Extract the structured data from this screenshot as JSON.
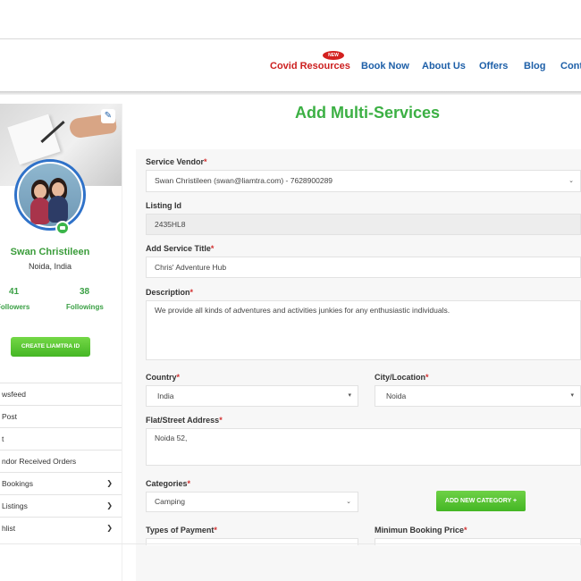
{
  "nav": {
    "badge": "NEW",
    "items": [
      "Covid Resources",
      "Book Now",
      "About Us",
      "Offers",
      "Blog",
      "Cont"
    ]
  },
  "profile": {
    "name": "Swan Christileen",
    "location": "Noida, India",
    "followers_count": "41",
    "followers_label": "Followers",
    "followings_count": "38",
    "followings_label": "Followings",
    "create_button": "CREATE LIAMTRA ID"
  },
  "menu": {
    "items": [
      "wsfeed",
      "Post",
      "t",
      "ndor Received Orders",
      "Bookings",
      "Listings",
      "hlist"
    ]
  },
  "form": {
    "title": "Add Multi-Services",
    "service_vendor_label": "Service Vendor",
    "service_vendor_value": "Swan Christileen (swan@liamtra.com) - 7628900289",
    "listing_id_label": "Listing Id",
    "listing_id_value": "2435HL8",
    "service_title_label": "Add Service Title",
    "service_title_value": "Chris' Adventure Hub",
    "description_label": "Description",
    "description_value": "We provide all kinds of adventures and activities junkies for any enthusiastic individuals.",
    "country_label": "Country",
    "country_value": "India",
    "city_label": "City/Location",
    "city_value": "Noida",
    "address_label": "Flat/Street Address",
    "address_value": "Noida 52,",
    "categories_label": "Categories",
    "categories_value": "Camping",
    "add_category_button": "ADD NEW CATEGORY +",
    "payment_label": "Types of Payment",
    "min_price_label": "Minimun Booking Price",
    "required_mark": "*"
  },
  "colors": {
    "accent_green": "#3cb044",
    "nav_blue": "#1d5fa8",
    "covid_red": "#cc1f1f"
  }
}
